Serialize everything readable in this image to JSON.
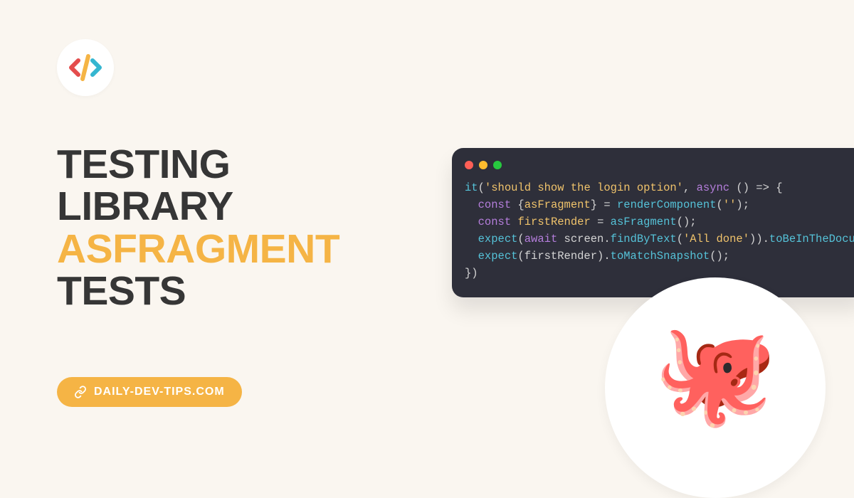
{
  "title": {
    "line1": "TESTING",
    "line2": "LIBRARY",
    "line3": "ASFRAGMENT",
    "line4": "TESTS"
  },
  "site": {
    "label": "DAILY-DEV-TIPS.COM"
  },
  "code": {
    "l1_fn": "it",
    "l1_p1": "(",
    "l1_str": "'should show the login option'",
    "l1_p2": ", ",
    "l1_kw": "async",
    "l1_p3": " () => {",
    "l2_kw": "const",
    "l2_p1": " {",
    "l2_var": "asFragment",
    "l2_p2": "} = ",
    "l2_fn": "renderComponent",
    "l2_p3": "(",
    "l2_str": "''",
    "l2_p4": ");",
    "l3_kw": "const",
    "l3_p1": " ",
    "l3_var": "firstRender",
    "l3_p2": " = ",
    "l3_fn": "asFragment",
    "l3_p3": "();",
    "l4_fn": "expect",
    "l4_p1": "(",
    "l4_kw": "await",
    "l4_p2": " screen.",
    "l4_prop": "findByText",
    "l4_p3": "(",
    "l4_str": "'All done'",
    "l4_p4": ")).",
    "l4_prop2": "toBeInTheDocume",
    "l5_fn": "expect",
    "l5_p1": "(firstRender).",
    "l5_prop": "toMatchSnapshot",
    "l5_p2": "();",
    "l6": "})"
  },
  "octopus": "🐙"
}
